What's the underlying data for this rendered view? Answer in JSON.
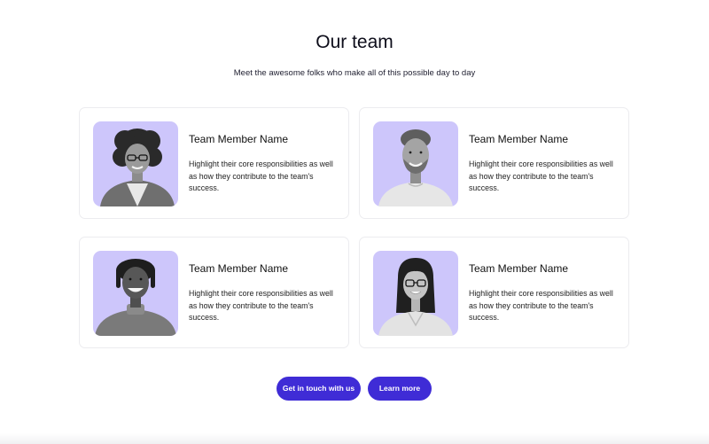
{
  "header": {
    "title": "Our team",
    "subtitle": "Meet the awesome folks who make all of this possible day to day"
  },
  "members": [
    {
      "name": "Team Member Name",
      "description": "Highlight their core responsibilities as well as how they contribute to the team's success."
    },
    {
      "name": "Team Member Name",
      "description": "Highlight their core responsibilities as well as how they contribute to the team's success."
    },
    {
      "name": "Team Member Name",
      "description": "Highlight their core responsibilities as well as how they contribute to the team's success."
    },
    {
      "name": "Team Member Name",
      "description": "Highlight their core responsibilities as well as how they contribute to the team's success."
    }
  ],
  "actions": {
    "contact_label": "Get in touch with us",
    "learn_label": "Learn more"
  },
  "colors": {
    "accent": "#3f2cd6",
    "photo_background": "#cdc6fb",
    "card_border": "#ececef"
  }
}
